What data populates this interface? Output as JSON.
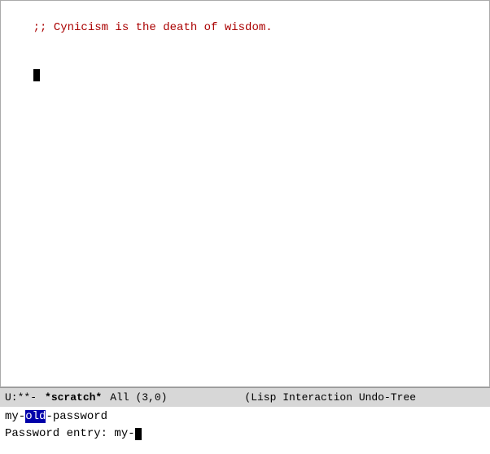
{
  "editor": {
    "line1": ";; Cynicism is the death of wisdom.",
    "line2_cursor": "",
    "background": "#ffffff",
    "foreground": "#000000"
  },
  "modeline": {
    "status": "U:**-",
    "buffername": "*scratch*",
    "position": "All (3,0)",
    "mode": "(Lisp Interaction Undo-Tree"
  },
  "minibuffer": {
    "line1_before_highlight": "my-",
    "line1_highlight": "old",
    "line1_after_highlight": "-password",
    "line2_label": "Password entry: my-"
  }
}
